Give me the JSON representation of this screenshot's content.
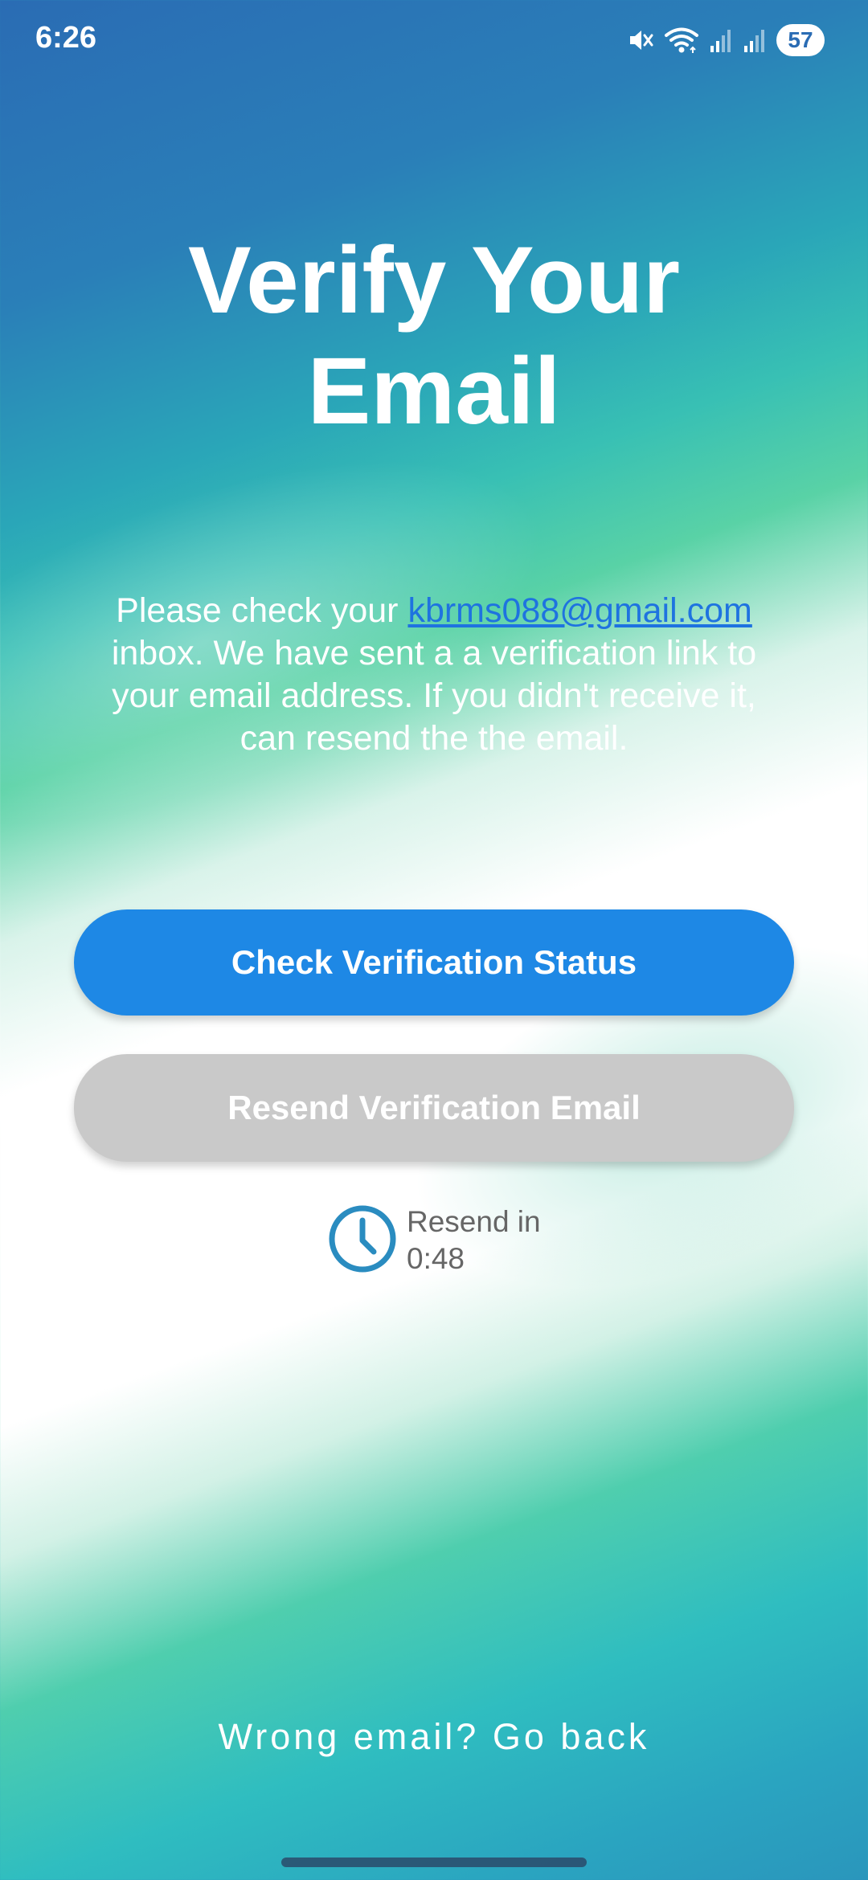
{
  "status_bar": {
    "time": "6:26",
    "battery": "57",
    "icons": [
      "mute-icon",
      "wifi-icon",
      "signal-icon",
      "signal-icon"
    ]
  },
  "title": {
    "line1": "Verify Your",
    "line2": "Email"
  },
  "message": {
    "prefix": "Please check your ",
    "email": "kbrms088@gmail.com",
    "suffix": " inbox. We have sent a a verification link to your email address. If you didn't receive it, can resend the the email."
  },
  "buttons": {
    "check_label": "Check Verification Status",
    "resend_label": "Resend Verification Email"
  },
  "timer": {
    "label": "Resend in",
    "value": "0:48",
    "icon": "clock-icon"
  },
  "footer": {
    "go_back": "Wrong email? Go back"
  },
  "colors": {
    "primary": "#1e88e5",
    "disabled": "#c9c9c9",
    "link": "#1e73e0",
    "timer_icon": "#2a8cc0"
  }
}
